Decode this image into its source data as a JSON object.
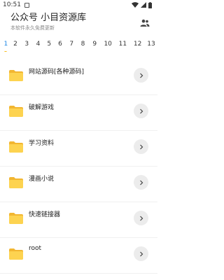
{
  "status_bar": {
    "time": "10:51"
  },
  "header": {
    "title": "公众号 小目资源库",
    "subtitle": "本软件永久免费更新",
    "account_icon": "account-group-icon"
  },
  "tabs": [
    "1",
    "2",
    "3",
    "4",
    "5",
    "6",
    "7",
    "8",
    "9",
    "10",
    "11",
    "12",
    "13"
  ],
  "active_tab": "1",
  "items": [
    {
      "label": "网站源码[各种源码]"
    },
    {
      "label": "破解游戏"
    },
    {
      "label": "学习资料"
    },
    {
      "label": "漫画小说"
    },
    {
      "label": "快速链接器"
    },
    {
      "label": "root"
    }
  ],
  "colors": {
    "accent": "#1e88e5",
    "folder": "#f7c948",
    "dot": "#f5b400"
  }
}
